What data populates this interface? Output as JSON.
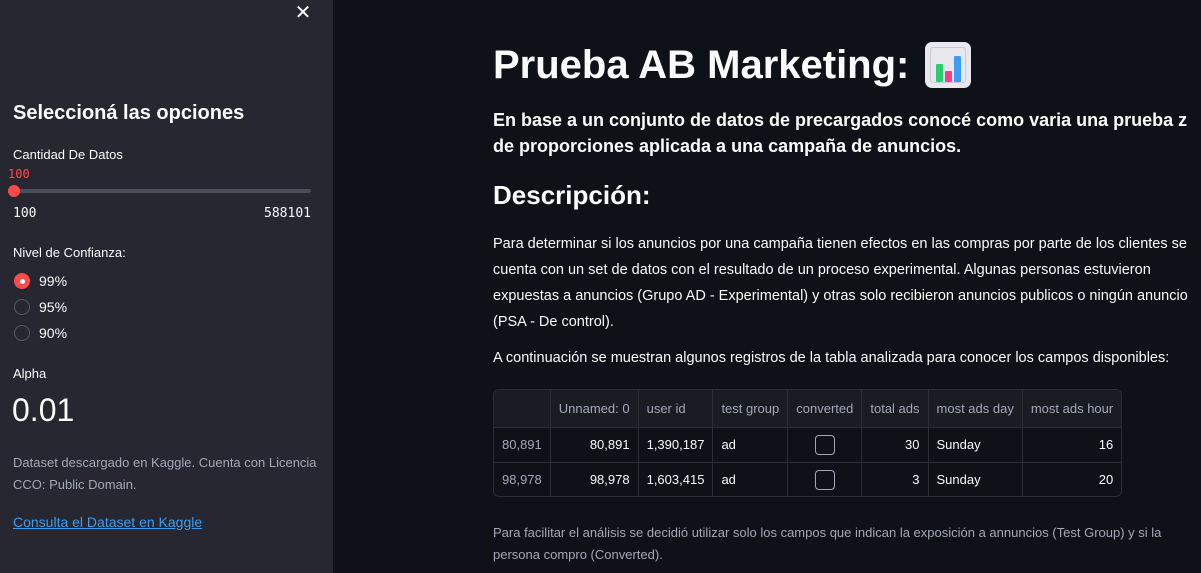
{
  "sidebar": {
    "close_label": "✕",
    "title": "Seleccioná las opciones",
    "slider": {
      "label": "Cantidad De Datos",
      "value": "100",
      "min": "100",
      "max": "588101",
      "fraction": 0
    },
    "radio": {
      "label": "Nivel de Confianza:",
      "options": [
        "99%",
        "95%",
        "90%"
      ],
      "selected": "99%"
    },
    "metric": {
      "label": "Alpha",
      "value": "0.01"
    },
    "note": "Dataset descargado en Kaggle. Cuenta con Licencia CCO: Public Domain.",
    "link": "Consulta el Dataset en Kaggle"
  },
  "main": {
    "title": "Prueba AB Marketing:",
    "title_icon": "bar-chart-icon",
    "subtitle": "En base a un conjunto de datos de precargados conocé como varia una prueba z de proporciones aplicada a una campaña de anuncios.",
    "section_title": "Descripción:",
    "description": "Para determinar si los anuncios por una campaña tienen efectos en las compras por parte de los clientes se cuenta con un set de datos con el resultado de un proceso experimental. Algunas personas estuvieron expuestas a anuncios (Grupo AD - Experimental) y otras solo recibieron anuncios publicos o ningún anuncio (PSA - De control).",
    "table_intro": "A continuación se muestran algunos registros de la tabla analizada para conocer los campos disponibles:",
    "table": {
      "columns": [
        "",
        "Unnamed: 0",
        "user id",
        "test group",
        "converted",
        "total ads",
        "most ads day",
        "most ads hour"
      ],
      "rows": [
        {
          "index": "80,891",
          "unnamed": "80,891",
          "user_id": "1,390,187",
          "test_group": "ad",
          "converted": false,
          "total_ads": "30",
          "most_ads_day": "Sunday",
          "most_ads_hour": "16"
        },
        {
          "index": "98,978",
          "unnamed": "98,978",
          "user_id": "1,603,415",
          "test_group": "ad",
          "converted": false,
          "total_ads": "3",
          "most_ads_day": "Sunday",
          "most_ads_hour": "20"
        }
      ]
    },
    "footnote": "Para facilitar el análisis se decidió utilizar solo los campos que indican la exposición a annuncios (Test Group) y si la persona compro (Converted)."
  },
  "colors": {
    "accent": "#ff4b4b",
    "sidebar_bg": "#262730",
    "main_bg": "#0e1117",
    "link": "#3d9df3"
  }
}
